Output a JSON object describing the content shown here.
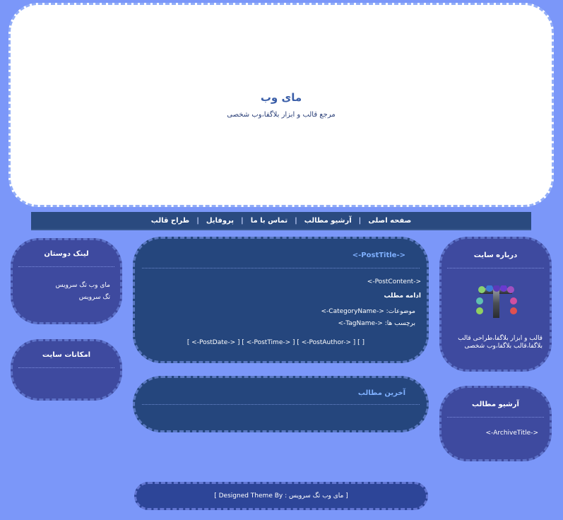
{
  "header": {
    "title": "ماى وب",
    "description": "مرجع قالب و ابزار بلاگفا،وب شخصى"
  },
  "nav": {
    "items": [
      "صفحه اصلی",
      "آرشیو مطالب",
      "تماس با ما",
      "پروفایل",
      "طراح قالب"
    ],
    "separator": "|"
  },
  "left_sidebar": {
    "friends_links": {
      "title": "لینک دوستان",
      "links": [
        "مای وب تگ سرویس",
        "تگ سرویس"
      ]
    },
    "site_features": {
      "title": "امکانات سایت"
    }
  },
  "post": {
    "title": "<-PostTitle->",
    "content": "<-PostContent->",
    "read_more": "ادامه مطلب",
    "categories_line": "موضوعات: <-CategoryName->",
    "tags_line": "برچسب ها: <-TagName->",
    "meta_line": "[ <-PostDate-> ] [ <-PostTime-> ] [ <-PostAuthor-> ] [ ]"
  },
  "latest_posts": {
    "title": "آخرین مطالب"
  },
  "right_sidebar": {
    "about": {
      "title": "درباره سایت",
      "text": "قالب و ابزار بلاگفا،طراحى قالب بلاگفا،قالب بلاگفا،وب شخصى"
    },
    "archive": {
      "title": "آرشیو مطالب",
      "item": "<-ArchiveTitle->"
    }
  },
  "footer": {
    "text": "[ Designed Theme By : مای وب تگ سرویس ]"
  },
  "colors": {
    "background": "#7b97f9",
    "header_bg": "#ffffff",
    "nav_bg": "#2a4a7f",
    "sidebar_bg": "#3e4a9f",
    "main_bg": "#25467d",
    "accent_title": "#7fb0ff"
  }
}
